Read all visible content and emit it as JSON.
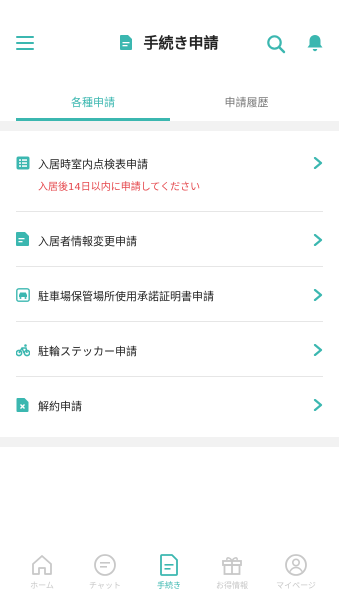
{
  "header": {
    "title": "手続き申請"
  },
  "tabs": [
    {
      "label": "各種申請",
      "active": true
    },
    {
      "label": "申請履歴",
      "active": false
    }
  ],
  "items": [
    {
      "icon": "checklist-icon",
      "label": "入居時室内点検表申請",
      "note": "入居後14日以内に申請してください"
    },
    {
      "icon": "document-edit-icon",
      "label": "入居者情報変更申請",
      "note": ""
    },
    {
      "icon": "car-icon",
      "label": "駐車場保管場所使用承諾証明書申請",
      "note": ""
    },
    {
      "icon": "bicycle-icon",
      "label": "駐輪ステッカー申請",
      "note": ""
    },
    {
      "icon": "cancel-document-icon",
      "label": "解約申請",
      "note": ""
    }
  ],
  "bottom_nav": [
    {
      "icon": "home-icon",
      "label": "ホーム",
      "active": false
    },
    {
      "icon": "chat-icon",
      "label": "チャット",
      "active": false
    },
    {
      "icon": "document-icon",
      "label": "手続き",
      "active": true
    },
    {
      "icon": "gift-icon",
      "label": "お得情報",
      "active": false
    },
    {
      "icon": "user-icon",
      "label": "マイページ",
      "active": false
    }
  ],
  "colors": {
    "accent": "#3bb7b0",
    "warning_text": "#e5484d",
    "inactive_nav": "#c8c8c8"
  }
}
